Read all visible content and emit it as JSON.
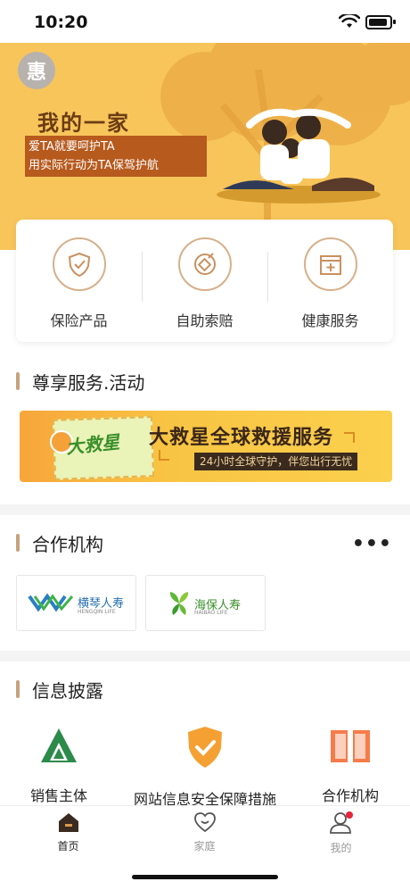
{
  "status": {
    "time": "10:20"
  },
  "hero": {
    "logo_text": "惠",
    "title": "我的一家",
    "subtitle_line1": "爱TA就要呵护TA",
    "subtitle_line2": "用实际行动为TA保驾护航"
  },
  "menu": [
    {
      "label": "保险产品",
      "icon": "shield-check-icon"
    },
    {
      "label": "自助索赔",
      "icon": "claim-target-icon"
    },
    {
      "label": "健康服务",
      "icon": "medical-kit-icon"
    }
  ],
  "section_service": {
    "title": "尊享服务.活动"
  },
  "banner": {
    "badge": "大救星",
    "title": "大救星全球救援服务",
    "subtitle": "24小时全球守护，伴您出行无忧"
  },
  "section_partners": {
    "title": "合作机构",
    "more": "•••",
    "items": [
      {
        "name": "横琴人寿",
        "sub": "HENGQIN LIFE"
      },
      {
        "name": "海保人寿",
        "sub": "HAIBAO LIFE"
      }
    ]
  },
  "section_info": {
    "title": "信息披露",
    "items": [
      {
        "label": "销售主体",
        "icon": "mountain-logo-icon"
      },
      {
        "label": "网站信息安全保障措施",
        "icon": "shield-check-icon"
      },
      {
        "label": "合作机构",
        "icon": "book-icon"
      }
    ]
  },
  "tabbar": [
    {
      "label": "首页",
      "icon": "home-icon",
      "active": true
    },
    {
      "label": "家庭",
      "icon": "heart-face-icon",
      "active": false
    },
    {
      "label": "我的",
      "icon": "user-icon",
      "active": false
    }
  ],
  "colors": {
    "hero_bg": "#f8c55b",
    "accent": "#c8a27c",
    "title_brown": "#6b3c13"
  }
}
